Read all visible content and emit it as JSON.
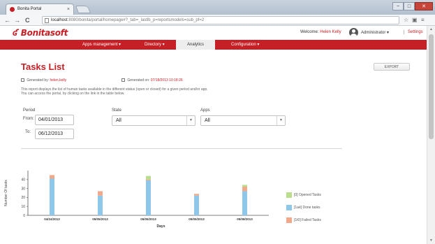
{
  "browser": {
    "tab_title": "Bonita Portal",
    "tab_close": "×",
    "back": "←",
    "forward": "→",
    "reload": "C",
    "url_host": "localhost",
    "url_rest": ":8080/bonita/portal/homepage#?_tab=_lastlb_p=reportsmodels=sub_pf=2",
    "bookmark_icon": "star-icon",
    "win_min": "−",
    "win_max": "□",
    "win_close": "✕"
  },
  "header": {
    "logo": "Bonitasoft",
    "welcome_prefix": "Welcome:",
    "welcome_user": "Helen Kelly",
    "role": "Administrator ▾",
    "settings": "Settings"
  },
  "menu": {
    "items": [
      {
        "label": "Apps management  ▾"
      },
      {
        "label": "Directory  ▾"
      },
      {
        "label": "Analytics"
      },
      {
        "label": "Configuration  ▾"
      }
    ],
    "active_index": 2
  },
  "page": {
    "title": "Tasks List",
    "export_label": "EXPORT",
    "generated_by_label": "Generated by:",
    "generated_by_value": "helen.kelly",
    "generated_on_label": "Generated on:",
    "generated_on_value": "07/18/2013 10:18:26",
    "description_line1": "This report displays the list of human tasks available in the different status (open or closed) for a given period and/or app.",
    "description_line2": "You can access the portal, by clicking on the link in the table below."
  },
  "filters": {
    "period_label": "Period",
    "from_label": "From:",
    "from_value": "04/01/2013",
    "to_label": "To:",
    "to_value": "06/12/2013",
    "state_label": "State",
    "state_value": "All",
    "apps_label": "Apps",
    "apps_value": "All"
  },
  "chart_data": {
    "type": "bar",
    "stacked": true,
    "xlabel": "Days",
    "ylabel": "Number Of tasks",
    "ylim": [
      0,
      50
    ],
    "yticks": [
      0,
      10,
      20,
      30,
      40
    ],
    "categories": [
      "04/24/2013",
      "05/05/2013",
      "05/05/2013",
      "05/05/2013",
      "05/08/2013"
    ],
    "series": [
      {
        "name": "[0] Opened Tasks",
        "color": "#b9df8e",
        "values": [
          0,
          0,
          4,
          0,
          2
        ]
      },
      {
        "name": "[1aè] Done tasks",
        "color": "#8ec7ea",
        "values": [
          41,
          22,
          39,
          22,
          27
        ]
      },
      {
        "name": "[1t0] Failed Tasks",
        "color": "#f0a98b",
        "values": [
          4,
          5,
          1,
          2,
          5
        ]
      }
    ],
    "legend_position": "right"
  },
  "colors": {
    "brand": "#c62026"
  }
}
